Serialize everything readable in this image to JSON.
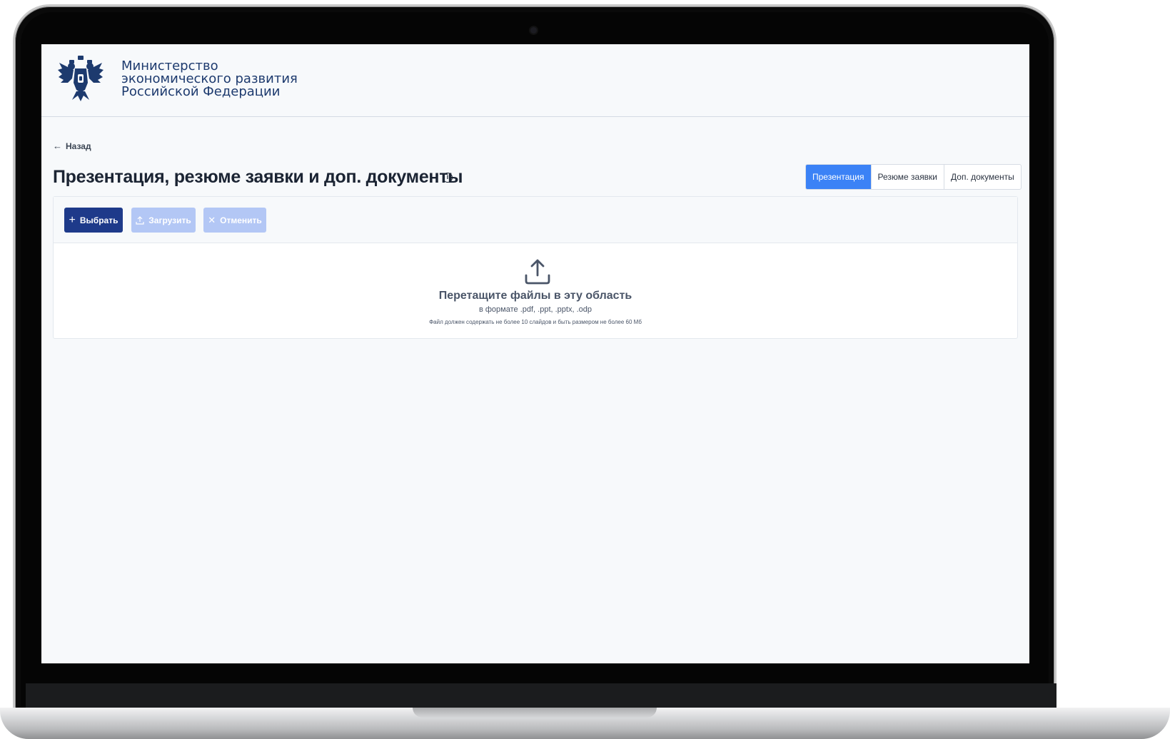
{
  "header": {
    "org_line1": "Министерство",
    "org_line2": "экономического развития",
    "org_line3": "Российской Федерации",
    "emblem_icon": "double-headed-eagle-emblem"
  },
  "nav": {
    "back_label": "Назад"
  },
  "page": {
    "title": "Презентация, резюме заявки и доп. документы",
    "info_glyph": "i"
  },
  "tabs": [
    {
      "label": "Презентация",
      "active": true
    },
    {
      "label": "Резюме заявки",
      "active": false
    },
    {
      "label": "Доп. документы",
      "active": false
    }
  ],
  "upload": {
    "select_label": "Выбрать",
    "upload_label": "Загрузить",
    "cancel_label": "Отменить",
    "drop_title": "Перетащите файлы в эту область",
    "drop_formats": "в формате .pdf, .ppt, .pptx, .odp",
    "drop_limits": "Файл должен содержать не более 10 слайдов и быть размером не более 60 Мб"
  },
  "colors": {
    "primary": "#1e3a8a",
    "tab_active": "#3b82f6",
    "disabled": "#b3c7f5",
    "org_text": "#1d3a6e"
  }
}
